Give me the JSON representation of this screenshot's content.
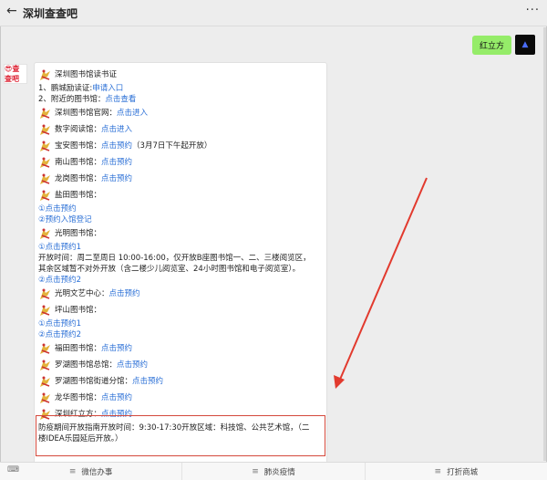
{
  "header": {
    "back_icon": "back-arrow-icon",
    "title": "深圳查查吧",
    "more": "···"
  },
  "user_message": {
    "text": "红立方"
  },
  "bot": {
    "avatar_text": "😎查查吧"
  },
  "card": {
    "title": "深圳图书馆读书证",
    "l1_prefix": "1、鹏城励读证:",
    "l1_link": "申请入口",
    "l2_prefix": "2、附近的图书馆：",
    "l2_link": "点击查看",
    "sz_label": "深圳图书馆官网：",
    "sz_link": "点击进入",
    "digital_label": "数字阅读馆：",
    "digital_link": "点击进入",
    "baoan_label": "宝安图书馆：",
    "baoan_link": "点击预约",
    "baoan_note": "（3月7日下午起开放）",
    "nanshan_label": "南山图书馆：",
    "nanshan_link": "点击预约",
    "longgang_label": "龙岗图书馆：",
    "longgang_link": "点击预约",
    "yantian_label": "盐田图书馆：",
    "yantian_1": "①点击预约",
    "yantian_2": "②预约入馆登记",
    "guangming_label": "光明图书馆：",
    "guangming_1": "①点击预约1",
    "guangming_hours_a": "开放时间：周二至周日 10:00-16:00，仅开放B座图书馆一、二、三楼阅览区，",
    "guangming_hours_b": "其余区域暂不对外开放（含二楼少儿阅览室、24小时图书馆和电子阅览室）。",
    "guangming_2": "②点击预约2",
    "gm_art_label": "光明文艺中心：",
    "gm_art_link": "点击预约",
    "pingshan_label": "坪山图书馆：",
    "pingshan_1": "①点击预约1",
    "pingshan_2": "②点击预约2",
    "futian_label": "福田图书馆：",
    "futian_link": "点击预约",
    "luohu_label": "罗湖图书馆总馆：",
    "luohu_link": "点击预约",
    "luohu_street_label": "罗湖图书馆街道分馆：",
    "luohu_street_link": "点击预约",
    "longhua_label": "龙华图书馆：",
    "longhua_link": "点击预约",
    "hlf_label": "深圳红立方：",
    "hlf_link": "点击预约",
    "hlf_note_a": "防疫期间开放指南开放时间：9:30-17:30开放区域：科技馆、公共艺术馆，（二",
    "hlf_note_b": "楼IDEA乐园延后开放。）"
  },
  "bottom": {
    "tabs": [
      "微信办事",
      "肺炎疫情",
      "打折商城"
    ],
    "keyboard_icon": "keyboard-icon",
    "menu_icon": "menu-icon"
  }
}
